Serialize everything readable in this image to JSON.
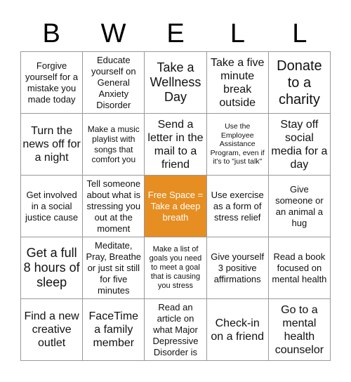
{
  "header": {
    "letters": [
      "B",
      "W",
      "E",
      "L",
      "L"
    ]
  },
  "free_color": "#e68e22",
  "cells": [
    {
      "text": "Forgive yourself for a mistake you made today",
      "size": "s3"
    },
    {
      "text": "Educate yourself on General Anxiety Disorder",
      "size": "s3"
    },
    {
      "text": "Take a Wellness Day",
      "size": "s1"
    },
    {
      "text": "Take a five minute break outside",
      "size": "s2"
    },
    {
      "text": "Donate to a charity",
      "size": "s0"
    },
    {
      "text": "Turn the news off for a night",
      "size": "s2"
    },
    {
      "text": "Make a music playlist with songs that comfort you",
      "size": "s4"
    },
    {
      "text": "Send a letter in the mail to a friend",
      "size": "s2"
    },
    {
      "text": "Use the Employee Assistance Program, even if it's to \"just talk\"",
      "size": "s6"
    },
    {
      "text": "Stay off social media for a day",
      "size": "s2"
    },
    {
      "text": "Get involved in a social justice cause",
      "size": "s3"
    },
    {
      "text": "Tell someone about what is stressing you out at the moment",
      "size": "s3"
    },
    {
      "text": "Free Space = Take a deep breath",
      "size": "s3",
      "free": true
    },
    {
      "text": "Use exercise as a form of stress relief",
      "size": "s3"
    },
    {
      "text": "Give someone or an animal a hug",
      "size": "s3"
    },
    {
      "text": "Get a full 8 hours of sleep",
      "size": "s1"
    },
    {
      "text": "Meditate, Pray, Breathe or just sit still for five minutes",
      "size": "s3"
    },
    {
      "text": "Make a list of goals you need to meet a goal that is causing you stress",
      "size": "s5"
    },
    {
      "text": "Give yourself 3 positive affirmations",
      "size": "s3"
    },
    {
      "text": "Read a book focused on mental health",
      "size": "s3"
    },
    {
      "text": "Find a new creative outlet",
      "size": "s2"
    },
    {
      "text": "FaceTime a family member",
      "size": "s2"
    },
    {
      "text": "Read an article on what Major Depressive Disorder is",
      "size": "s3"
    },
    {
      "text": "Check-in on a friend",
      "size": "s2"
    },
    {
      "text": "Go to a mental health counselor",
      "size": "s2"
    }
  ]
}
